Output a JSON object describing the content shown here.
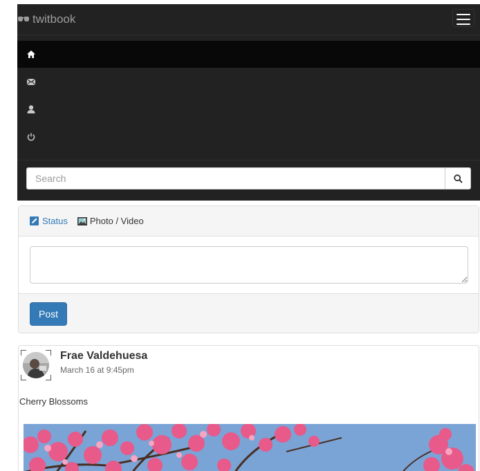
{
  "navbar": {
    "brand": "twitbook",
    "menu": [
      {
        "icon": "home-icon",
        "active": true
      },
      {
        "icon": "envelope-icon",
        "active": false
      },
      {
        "icon": "user-icon",
        "active": false
      },
      {
        "icon": "power-icon",
        "active": false
      }
    ],
    "search": {
      "placeholder": "Search",
      "value": ""
    }
  },
  "composer": {
    "tabs": [
      {
        "label": "Status",
        "icon": "edit-icon"
      },
      {
        "label": "Photo / Video",
        "icon": "picture-icon"
      }
    ],
    "post_label": "Post"
  },
  "post": {
    "author": "Frae Valdehuesa",
    "timestamp": "March 16 at 9:45pm",
    "text": "Cherry Blossoms"
  },
  "colors": {
    "navbar_bg": "#222222",
    "active_item_bg": "#080808",
    "primary": "#337ab7",
    "blossom": "#e85a8a",
    "sky": "#7ea5d8"
  }
}
